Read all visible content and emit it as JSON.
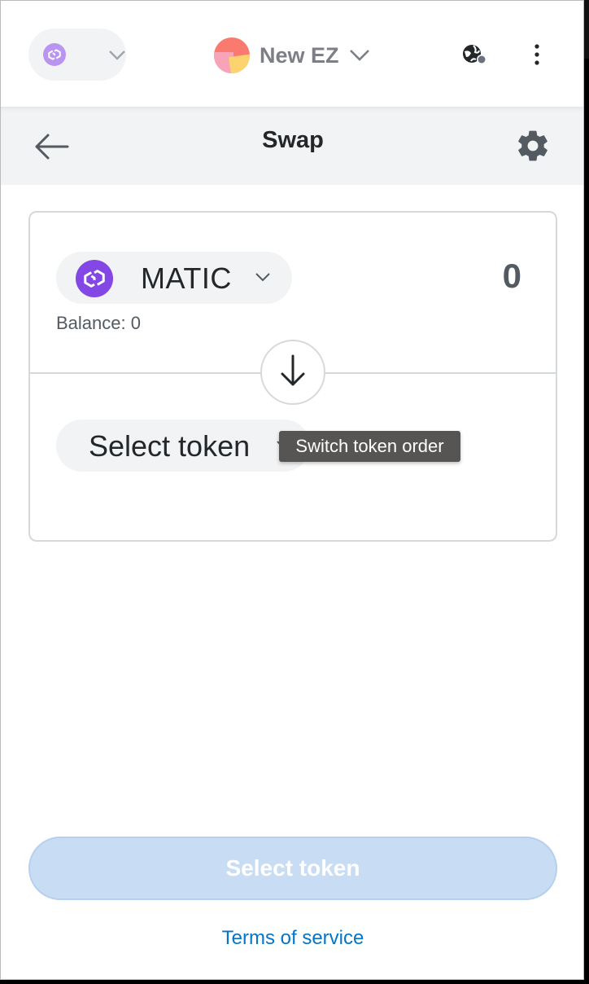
{
  "header": {
    "network_icon": "polygon-icon",
    "account_name": "New EZ",
    "connected_sites_icon": "globe-icon",
    "menu_icon": "kebab-menu-icon"
  },
  "page": {
    "title": "Swap",
    "back_icon": "arrow-left-icon",
    "settings_icon": "gear-icon"
  },
  "swap": {
    "from_token": {
      "symbol": "MATIC",
      "icon": "matic-icon",
      "amount": "0",
      "balance_text": "Balance: 0"
    },
    "switch_icon": "arrow-down-icon",
    "to_token": {
      "label": "Select token"
    },
    "tooltip": "Switch token order"
  },
  "footer": {
    "cta_label": "Select token",
    "terms_link": "Terms of service"
  },
  "colors": {
    "matic_purple": "#8247e5",
    "link_blue": "#0376c9",
    "cta_disabled": "#c8dcf4"
  }
}
